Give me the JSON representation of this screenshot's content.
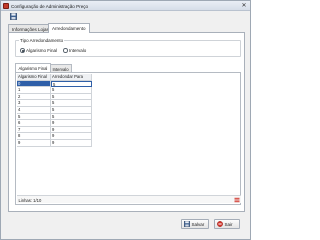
{
  "window": {
    "title": "Configuração de Administração Preço",
    "close_glyph": "✕"
  },
  "tabs": [
    {
      "label": "Informações Lojas",
      "active": false
    },
    {
      "label": "Arredondamento",
      "active": true
    }
  ],
  "rounding_type": {
    "legend": "Tipo Arredondamento",
    "options": [
      {
        "label": "Algarismo Final",
        "selected": true
      },
      {
        "label": "Intervalo",
        "selected": false
      }
    ]
  },
  "subtabs": [
    {
      "label": "Algarismo Final",
      "active": true
    },
    {
      "label": "Intervalo",
      "active": false
    }
  ],
  "grid": {
    "columns": [
      "Algarismo Final",
      "Arredondar Para"
    ],
    "rows": [
      [
        "0",
        "5"
      ],
      [
        "1",
        "5"
      ],
      [
        "2",
        "5"
      ],
      [
        "3",
        "5"
      ],
      [
        "4",
        "5"
      ],
      [
        "5",
        "5"
      ],
      [
        "6",
        "9"
      ],
      [
        "7",
        "9"
      ],
      [
        "8",
        "9"
      ],
      [
        "9",
        "9"
      ]
    ],
    "selected_row": 0,
    "status": "Linhas: 1/10"
  },
  "buttons": {
    "save": "Salvar",
    "exit": "Sair"
  },
  "colors": {
    "selection": "#2f5fa8",
    "app_icon": "#c23a2b",
    "exit_icon": "#d0332a"
  }
}
